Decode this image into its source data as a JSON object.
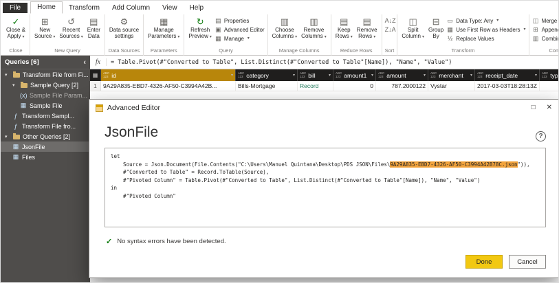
{
  "icons": {
    "caret": "▾",
    "fx": "fx",
    "check": "✓",
    "close": "✕",
    "maximize": "□",
    "help": "?",
    "collapse": "‹",
    "expanded": "▾",
    "corner": "▦",
    "close_apply": "✓",
    "new_source": "⊞",
    "recent_sources": "↺",
    "enter_data": "▤",
    "settings": "⚙",
    "manage_params": "▦",
    "refresh": "↻",
    "properties": "▤",
    "adv_editor": "▣",
    "manage": "▦",
    "choose_cols": "▥",
    "remove_cols": "▥",
    "keep_rows": "▤",
    "remove_rows": "▤",
    "sort_asc": "A↓Z",
    "sort_desc": "Z↓A",
    "split_col": "◫",
    "group_by": "⊟",
    "data_type": "▭",
    "first_row": "▦",
    "replace": "½",
    "merge": "◫",
    "append": "⊞",
    "combine_files": "▥",
    "function": "ƒ",
    "parameter": "(x)",
    "query": "▦"
  },
  "ribbon": {
    "file_tab": "File",
    "tabs": [
      "Home",
      "Transform",
      "Add Column",
      "View",
      "Help"
    ],
    "close_group": {
      "label": "Close",
      "close_apply": {
        "l1": "Close &",
        "l2": "Apply"
      }
    },
    "new_query_group": {
      "label": "New Query",
      "new_source": {
        "l1": "New",
        "l2": "Source"
      },
      "recent_sources": {
        "l1": "Recent",
        "l2": "Sources"
      },
      "enter_data": {
        "l1": "Enter",
        "l2": "Data"
      }
    },
    "data_sources_group": {
      "label": "Data Sources",
      "settings": {
        "l1": "Data source",
        "l2": "settings"
      }
    },
    "parameters_group": {
      "label": "Parameters",
      "manage_parameters": {
        "l1": "Manage",
        "l2": "Parameters"
      }
    },
    "query_group": {
      "label": "Query",
      "refresh": {
        "l1": "Refresh",
        "l2": "Preview"
      },
      "properties": "Properties",
      "advanced_editor": "Advanced Editor",
      "manage": "Manage"
    },
    "manage_columns_group": {
      "label": "Manage Columns",
      "choose": {
        "l1": "Choose",
        "l2": "Columns"
      },
      "remove": {
        "l1": "Remove",
        "l2": "Columns"
      }
    },
    "reduce_rows_group": {
      "label": "Reduce Rows",
      "keep": {
        "l1": "Keep",
        "l2": "Rows"
      },
      "remove": {
        "l1": "Remove",
        "l2": "Rows"
      }
    },
    "sort_group": {
      "label": "Sort"
    },
    "transform_group": {
      "label": "Transform",
      "split": {
        "l1": "Split",
        "l2": "Column"
      },
      "group_by": {
        "l1": "Group",
        "l2": "By"
      },
      "data_type": "Data Type: Any",
      "first_row": "Use First Row as Headers",
      "replace": "Replace Values"
    },
    "combine_group": {
      "label": "Combine",
      "merge": "Merge Queries",
      "append": "Append Queries",
      "combine_files": "Combine Files"
    }
  },
  "sidebar": {
    "header": "Queries [6]",
    "items": [
      {
        "label": "Transform File from Fi..."
      },
      {
        "label": "Sample Query [2]"
      },
      {
        "label": "Sample File Param..."
      },
      {
        "label": "Sample File"
      },
      {
        "label": "Transform Sampl..."
      },
      {
        "label": "Transform File fro..."
      },
      {
        "label": "Other Queries [2]"
      },
      {
        "label": "JsonFile"
      },
      {
        "label": "Files"
      }
    ]
  },
  "formula_bar": {
    "formula": "= Table.Pivot(#\"Converted to Table\", List.Distinct(#\"Converted to Table\"[Name]), \"Name\", \"Value\")"
  },
  "grid": {
    "type_icon_top": "ABC",
    "type_icon_bottom": "123",
    "columns": [
      {
        "name": "id"
      },
      {
        "name": "category"
      },
      {
        "name": "bill"
      },
      {
        "name": "amount1"
      },
      {
        "name": "amount"
      },
      {
        "name": "merchant"
      },
      {
        "name": "receipt_date"
      },
      {
        "name": "type"
      }
    ],
    "rows": [
      {
        "num": "1",
        "id": "9A29A835-EBD7-4326-AF50-C3994A42B...",
        "category": "Bills-Mortgage",
        "bill": "Record",
        "amount1": "0",
        "amount": "787.2000122",
        "merchant": "Vystar",
        "receipt_date": "2017-03-03T18:28:13Z",
        "type": ""
      }
    ]
  },
  "dialog": {
    "title": "Advanced Editor",
    "query_name": "JsonFile",
    "code": {
      "l1": "let",
      "l2_pre": "    Source = Json.Document(File.Contents(\"C:\\Users\\Manuel Quintana\\Desktop\\PDS JSON\\Files\\",
      "l2_hl": "9A29A835-EBD7-4326-AF50-C3994A42B78C.json",
      "l2_post": "\")),",
      "l3": "    #\"Converted to Table\" = Record.ToTable(Source),",
      "l4": "    #\"Pivoted Column\" = Table.Pivot(#\"Converted to Table\", List.Distinct(#\"Converted to Table\"[Name]), \"Name\", \"Value\")",
      "l5": "in",
      "l6": "    #\"Pivoted Column\""
    },
    "status": "No syntax errors have been detected.",
    "done_label": "Done",
    "cancel_label": "Cancel"
  }
}
